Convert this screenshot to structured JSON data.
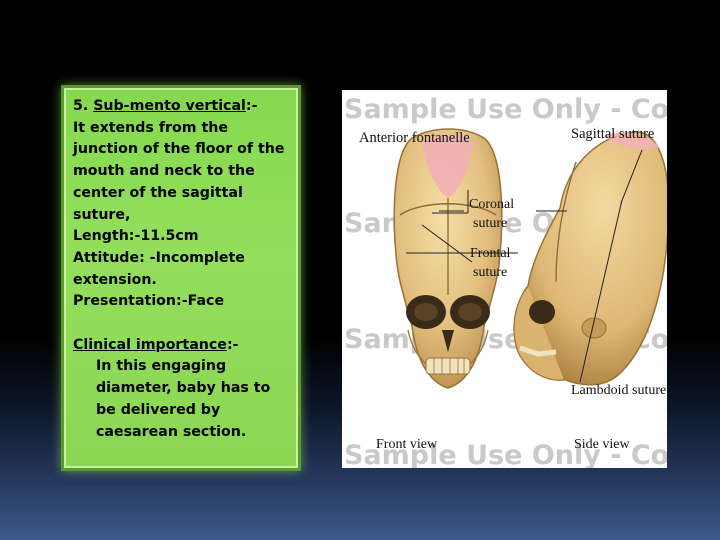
{
  "slide": {
    "heading_prefix": "5. ",
    "heading_term": "Sub-mento vertical",
    "heading_suffix": ":-",
    "line_extends": "It extends from the junction of the floor of the mouth and neck to the center of  the sagittal suture,",
    "line_length": "Length:-11.5cm",
    "line_attitude": "Attitude: -Incomplete extension.",
    "line_presentation": "Presentation:-Face",
    "clinical_term": "Clinical importance",
    "clinical_suffix": ":-",
    "clinical_text": "In this engaging diameter, baby has to be delivered by caesarean section."
  },
  "figure": {
    "watermark": "Sample Use Only - Copyrighted I",
    "labels": {
      "anterior_fontanelle": "Anterior fontanelle",
      "sagittal_suture": "Sagittal suture",
      "coronal": "Coronal",
      "coronal_suture": "suture",
      "frontal": "Frontal",
      "frontal_suture": "suture",
      "lambdoid_suture": "Lambdoid suture",
      "front_view": "Front view",
      "side_view": "Side view"
    },
    "colors": {
      "bone": "#e8c98c",
      "bone_shadow": "#b98d4a",
      "fontanelle": "#f2b0b5"
    }
  }
}
